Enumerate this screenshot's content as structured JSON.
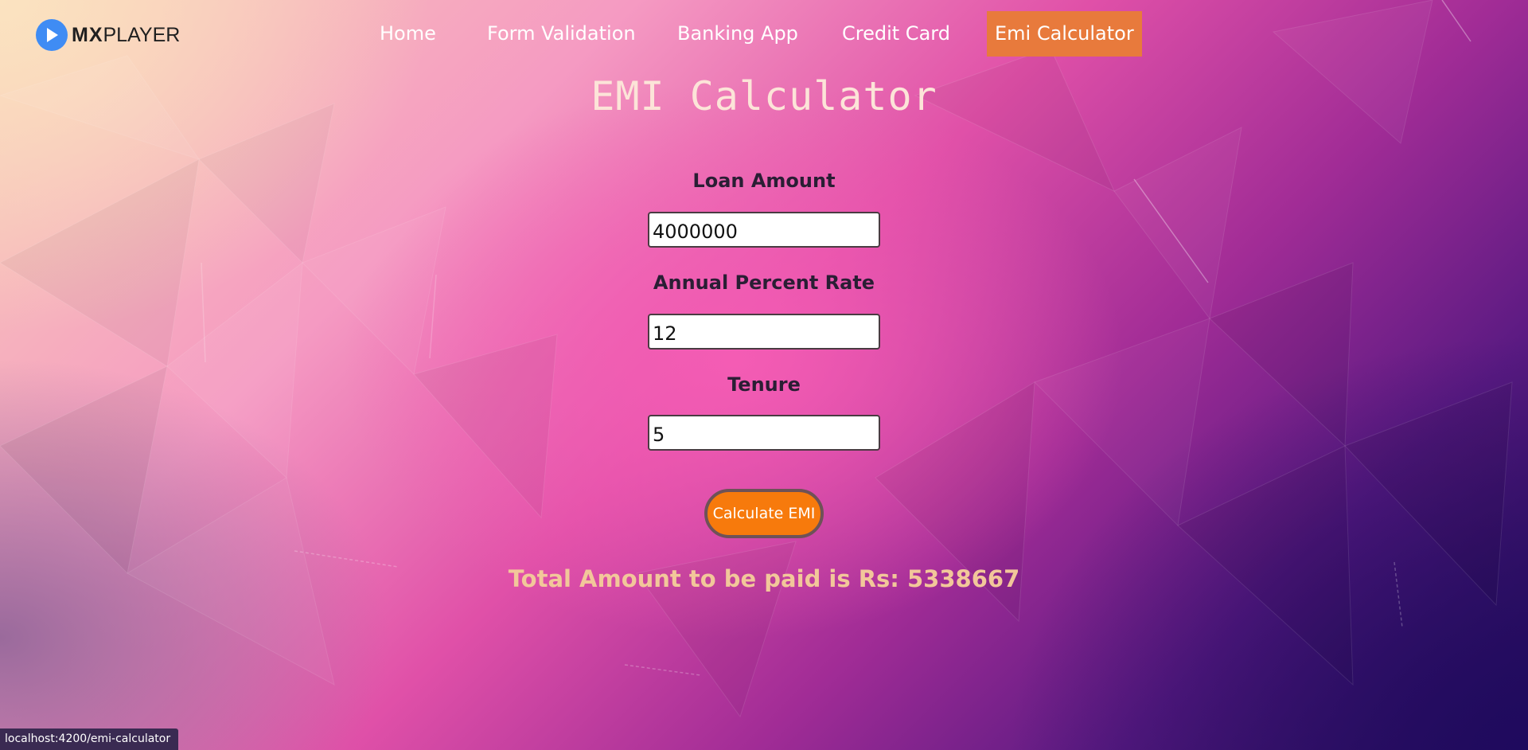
{
  "brand": {
    "name_bold": "MX",
    "name_regular": "PLAYER",
    "icon": "play-icon"
  },
  "nav": {
    "items": [
      {
        "label": "Home"
      },
      {
        "label": "Form Validation"
      },
      {
        "label": "Banking App"
      },
      {
        "label": "Credit Card"
      },
      {
        "label": "Emi Calculator",
        "active": true
      }
    ]
  },
  "page": {
    "title": "EMI Calculator"
  },
  "form": {
    "loan_amount_label": "Loan Amount",
    "loan_amount_value": "4000000",
    "rate_label": "Annual Percent Rate",
    "rate_value": "12",
    "tenure_label": "Tenure",
    "tenure_value": "5",
    "submit_label": "Calculate EMI"
  },
  "result": {
    "text": "Total Amount to be paid is Rs: 5338667"
  },
  "status_bar": {
    "url": "localhost:4200/emi-calculator"
  },
  "colors": {
    "accent": "#e87a3c",
    "button": "#f77a0c",
    "result_text": "#f2c79a",
    "title_text": "#fce4d8"
  }
}
